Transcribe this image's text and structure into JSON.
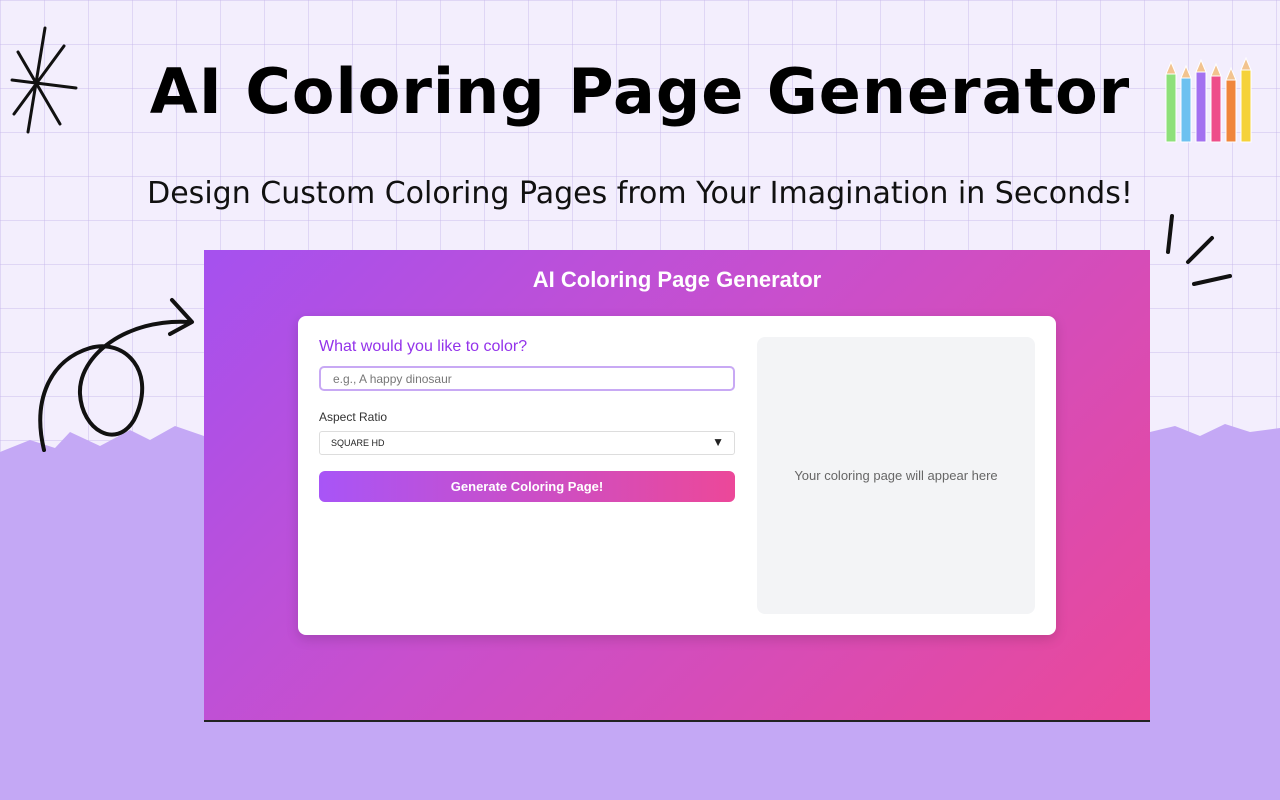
{
  "hero": {
    "title": "AI Coloring Page Generator",
    "subtitle": "Design Custom Coloring Pages from Your Imagination in Seconds!"
  },
  "app": {
    "title": "AI Coloring Page Generator",
    "prompt": {
      "label": "What would you like to color?",
      "placeholder": "e.g., A happy dinosaur",
      "value": ""
    },
    "aspect_ratio": {
      "label": "Aspect Ratio",
      "selected": "SQUARE HD",
      "caret": "▼"
    },
    "generate_label": "Generate Coloring Page!",
    "preview_placeholder": "Your coloring page will appear here"
  },
  "icons": [
    "sparkle-star-icon",
    "curly-arrow-icon",
    "spark-lines-icon",
    "colored-pencils-icon",
    "dropdown-caret-icon"
  ],
  "colors": {
    "page_background": "#f3eefd",
    "torn_paper": "#c4a8f5",
    "window_gradient_start": "#a551ef",
    "window_gradient_end": "#ea4899",
    "label_purple": "#9333ea",
    "preview_background": "#f3f4f6"
  }
}
